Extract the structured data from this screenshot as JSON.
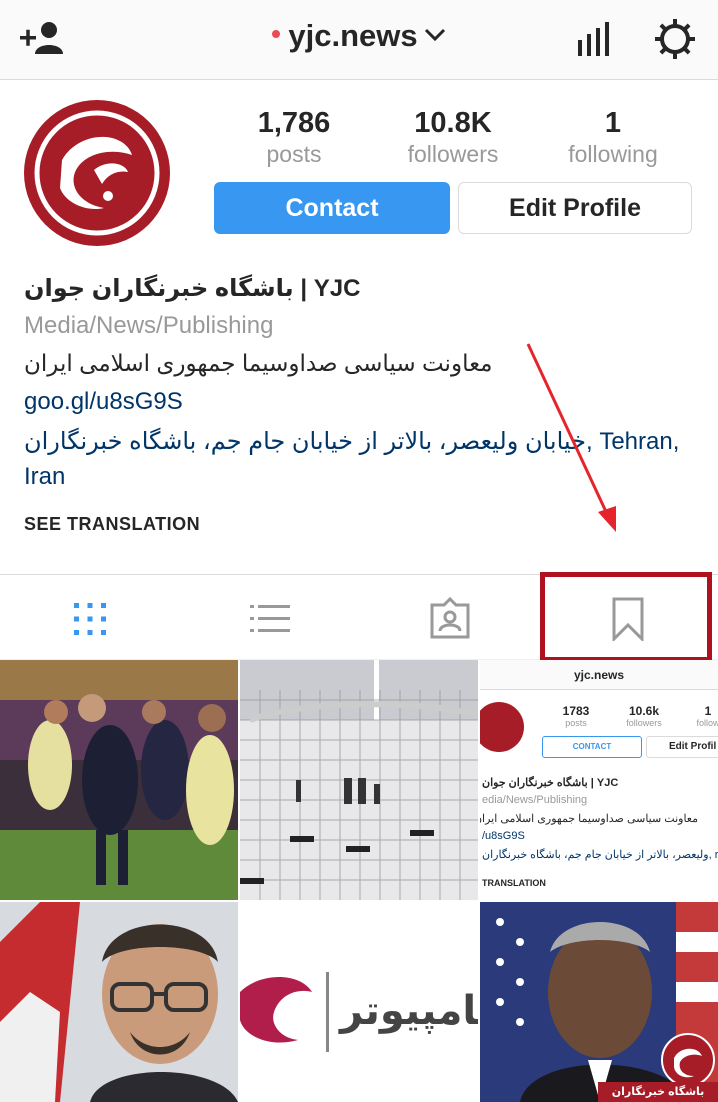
{
  "topbar": {
    "username": "yjc.news",
    "add_user_icon": "add-person-icon",
    "stats_icon": "bar-chart-icon",
    "settings_icon": "gear-icon"
  },
  "profile": {
    "stats": [
      {
        "value": "1,786",
        "label": "posts"
      },
      {
        "value": "10.8K",
        "label": "followers"
      },
      {
        "value": "1",
        "label": "following"
      }
    ],
    "contact_label": "Contact",
    "edit_label": "Edit Profile"
  },
  "bio": {
    "name": "باشگاه خبرنگاران جوان | YJC",
    "category": "Media/News/Publishing",
    "description": "معاونت سیاسی صداوسیما جمهوری اسلامی ایران",
    "link": "goo.gl/u8sG9S",
    "location": "خیابان ولیعصر، بالاتر از خیابان جام جم، باشگاه خبرنگاران, Tehran, Iran",
    "see_translation": "SEE TRANSLATION"
  },
  "tabs": [
    {
      "name": "grid",
      "icon": "grid-icon",
      "active": true
    },
    {
      "name": "list",
      "icon": "list-icon",
      "active": false
    },
    {
      "name": "tagged",
      "icon": "tagged-person-icon",
      "active": false
    },
    {
      "name": "saved",
      "icon": "bookmark-icon",
      "active": false
    }
  ],
  "mini_screenshot": {
    "username": "yjc.news",
    "posts": "1783",
    "posts_label": "posts",
    "followers": "10.6k",
    "followers_label": "followers",
    "following_label": "follow",
    "contact": "CONTACT",
    "edit": "Edit Profil",
    "name": "باشگاه خبرنگاران جوان | YJC",
    "category": "edia/News/Publishing",
    "description": "معاونت سیاسی صداوسیما جمهوری اسلامی ایران",
    "link": "/u8sG9S",
    "location": "ولیعصر، بالاتر از خیابان جام جم، باشگاه خبرنگاران, ran",
    "translation": "TRANSLATION"
  },
  "camip_tile": {
    "brand": "کامپیوتر"
  },
  "watermark": {
    "text": "باشگاه خبرنگاران"
  },
  "colors": {
    "accent": "#3897f0",
    "link": "#003569",
    "brand_red": "#a61d27",
    "highlight": "#b0111f"
  }
}
